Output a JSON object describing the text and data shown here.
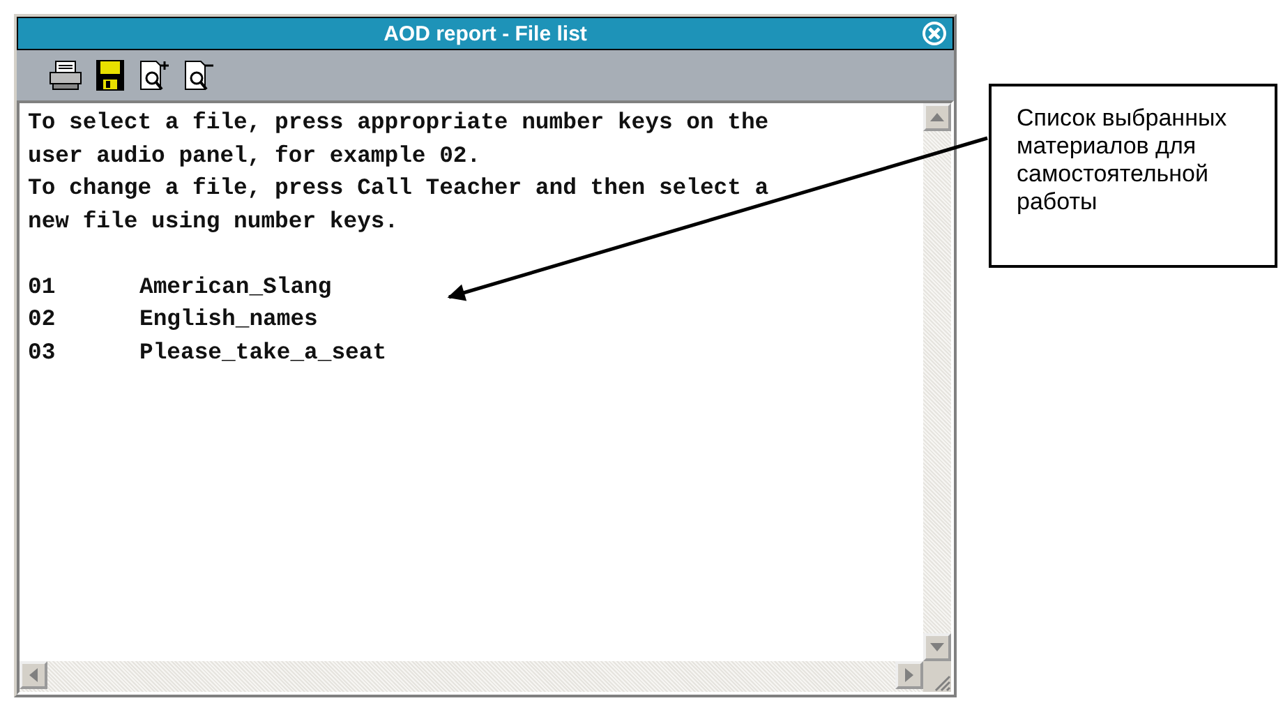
{
  "window": {
    "title": "AOD report - File list"
  },
  "instructions": [
    "To select a file, press appropriate number keys on the",
    "user audio panel, for example 02.",
    "To change a file, press Call Teacher and then select a",
    "new file using number keys."
  ],
  "files": [
    {
      "number": "01",
      "name": "American_Slang"
    },
    {
      "number": "02",
      "name": "English_names"
    },
    {
      "number": "03",
      "name": "Please_take_a_seat"
    }
  ],
  "callout": {
    "text": "Список выбранных материалов для самостоятельной работы"
  }
}
